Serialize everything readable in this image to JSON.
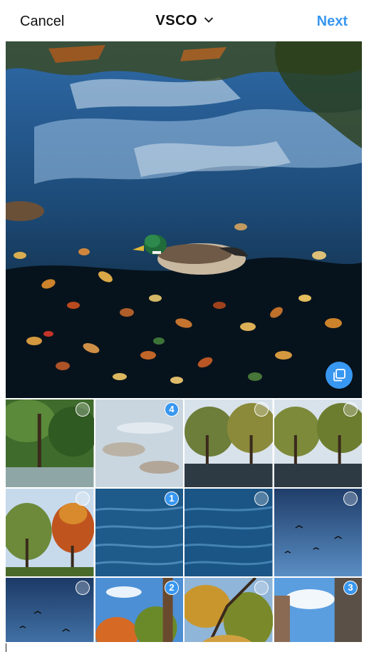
{
  "header": {
    "cancel_label": "Cancel",
    "title": "VSCO",
    "next_label": "Next"
  },
  "colors": {
    "accent": "#3897f0"
  },
  "preview": {
    "description_icon": "select-multiple-icon"
  },
  "grid": {
    "thumbnails": [
      {
        "scene": "trees-river",
        "selection": ""
      },
      {
        "scene": "leaves-water",
        "selection": "4"
      },
      {
        "scene": "trees-pond",
        "selection": ""
      },
      {
        "scene": "trees-pond",
        "selection": ""
      },
      {
        "scene": "autumn-trees",
        "selection": ""
      },
      {
        "scene": "water-ripples",
        "selection": "1"
      },
      {
        "scene": "water-ripples",
        "selection": ""
      },
      {
        "scene": "sky-birds",
        "selection": ""
      },
      {
        "scene": "sky-birds",
        "selection": ""
      },
      {
        "scene": "autumn-sky",
        "selection": "2"
      },
      {
        "scene": "autumn-branches",
        "selection": ""
      },
      {
        "scene": "building-sky",
        "selection": "3"
      }
    ]
  }
}
